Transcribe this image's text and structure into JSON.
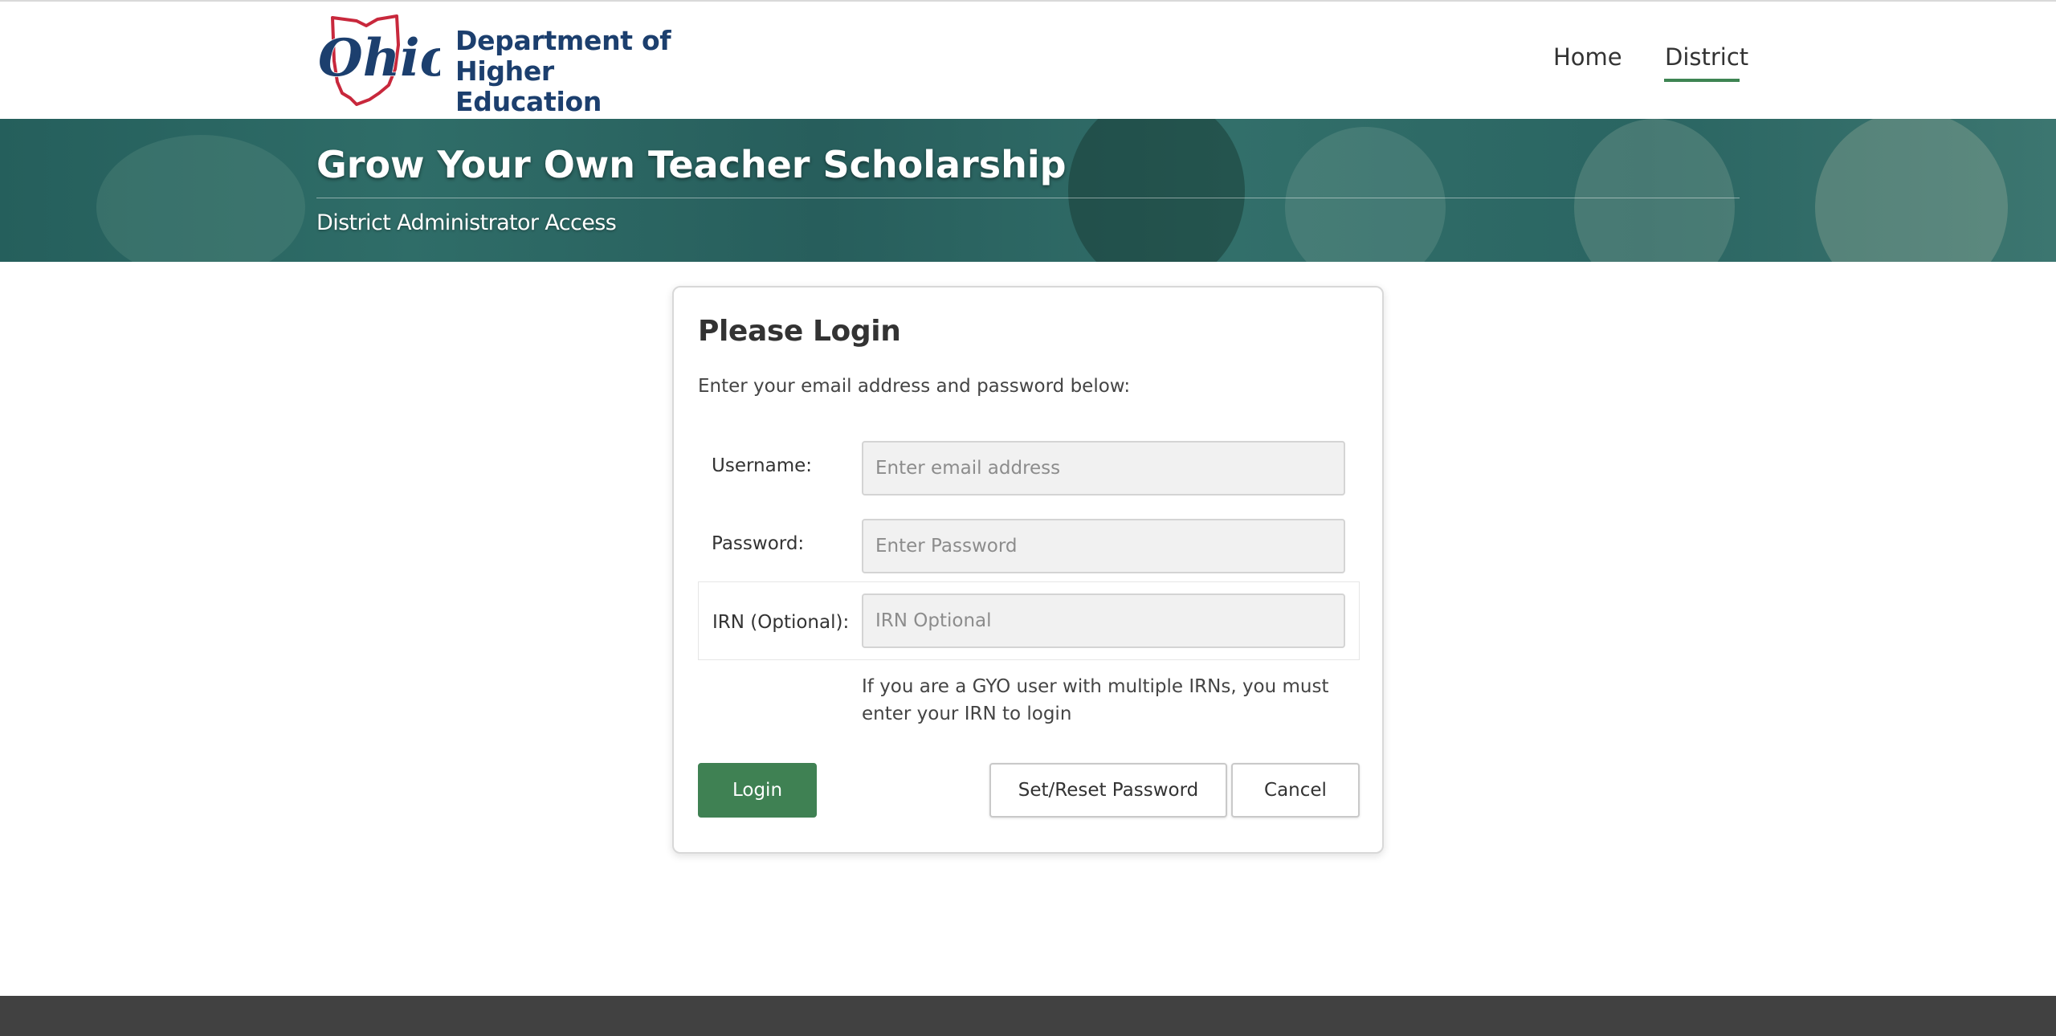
{
  "header": {
    "logo_script": "Ohio",
    "logo_line1": "Department of",
    "logo_line2": "Higher Education",
    "nav": [
      {
        "label": "Home"
      },
      {
        "label": "District",
        "active": true
      }
    ]
  },
  "banner": {
    "title": "Grow Your Own Teacher Scholarship",
    "subtitle": "District Administrator Access"
  },
  "login": {
    "title": "Please Login",
    "intro": "Enter your email address and password below:",
    "username_label": "Username:",
    "username_placeholder": "Enter email address",
    "username_value": "",
    "password_label": "Password:",
    "password_placeholder": "Enter Password",
    "password_value": "",
    "irn_label": "IRN (Optional):",
    "irn_placeholder": "IRN Optional",
    "irn_value": "",
    "irn_help": "If you are a GYO user with multiple IRNs, you must enter your IRN to login",
    "login_button": "Login",
    "reset_button": "Set/Reset Password",
    "cancel_button": "Cancel"
  },
  "colors": {
    "brand_blue": "#1c3f6e",
    "brand_red": "#c8283c",
    "accent_green": "#3f8153",
    "banner_teal": "#2a6562",
    "footer": "#414141"
  },
  "icons": {
    "logo": "ohio-state-outline-logo"
  }
}
